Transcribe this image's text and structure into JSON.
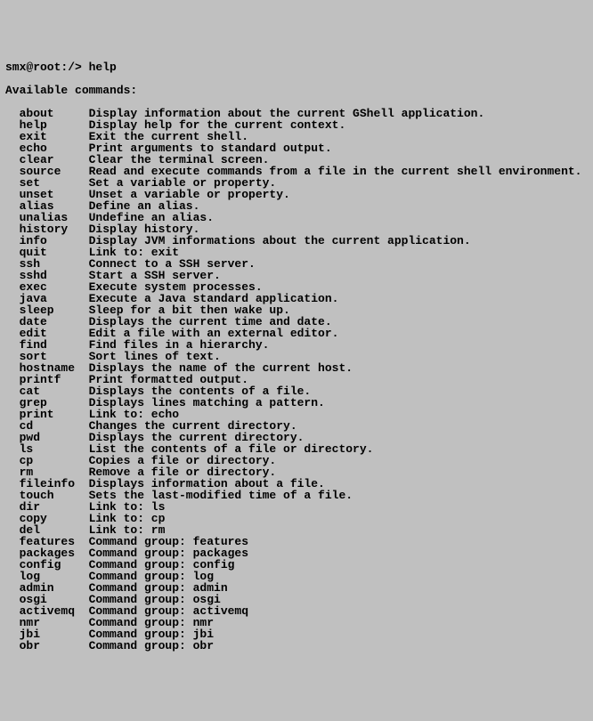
{
  "prompt": "smx@root:/> help",
  "header": "Available commands:",
  "commands": [
    {
      "name": "about",
      "desc": "Display information about the current GShell application."
    },
    {
      "name": "help",
      "desc": "Display help for the current context."
    },
    {
      "name": "exit",
      "desc": "Exit the current shell."
    },
    {
      "name": "echo",
      "desc": "Print arguments to standard output."
    },
    {
      "name": "clear",
      "desc": "Clear the terminal screen."
    },
    {
      "name": "source",
      "desc": "Read and execute commands from a file in the current shell environment."
    },
    {
      "name": "set",
      "desc": "Set a variable or property."
    },
    {
      "name": "unset",
      "desc": "Unset a variable or property."
    },
    {
      "name": "alias",
      "desc": "Define an alias."
    },
    {
      "name": "unalias",
      "desc": "Undefine an alias."
    },
    {
      "name": "history",
      "desc": "Display history."
    },
    {
      "name": "info",
      "desc": "Display JVM informations about the current application."
    },
    {
      "name": "quit",
      "desc": "Link to: exit"
    },
    {
      "name": "ssh",
      "desc": "Connect to a SSH server."
    },
    {
      "name": "sshd",
      "desc": "Start a SSH server."
    },
    {
      "name": "exec",
      "desc": "Execute system processes."
    },
    {
      "name": "java",
      "desc": "Execute a Java standard application."
    },
    {
      "name": "sleep",
      "desc": "Sleep for a bit then wake up."
    },
    {
      "name": "date",
      "desc": "Displays the current time and date."
    },
    {
      "name": "edit",
      "desc": "Edit a file with an external editor."
    },
    {
      "name": "find",
      "desc": "Find files in a hierarchy."
    },
    {
      "name": "sort",
      "desc": "Sort lines of text."
    },
    {
      "name": "hostname",
      "desc": "Displays the name of the current host."
    },
    {
      "name": "printf",
      "desc": "Print formatted output."
    },
    {
      "name": "cat",
      "desc": "Displays the contents of a file."
    },
    {
      "name": "grep",
      "desc": "Displays lines matching a pattern."
    },
    {
      "name": "print",
      "desc": "Link to: echo"
    },
    {
      "name": "cd",
      "desc": "Changes the current directory."
    },
    {
      "name": "pwd",
      "desc": "Displays the current directory."
    },
    {
      "name": "ls",
      "desc": "List the contents of a file or directory."
    },
    {
      "name": "cp",
      "desc": "Copies a file or directory."
    },
    {
      "name": "rm",
      "desc": "Remove a file or directory."
    },
    {
      "name": "fileinfo",
      "desc": "Displays information about a file."
    },
    {
      "name": "touch",
      "desc": "Sets the last-modified time of a file."
    },
    {
      "name": "dir",
      "desc": "Link to: ls"
    },
    {
      "name": "copy",
      "desc": "Link to: cp"
    },
    {
      "name": "del",
      "desc": "Link to: rm"
    },
    {
      "name": "features",
      "desc": "Command group: features"
    },
    {
      "name": "packages",
      "desc": "Command group: packages"
    },
    {
      "name": "config",
      "desc": "Command group: config"
    },
    {
      "name": "log",
      "desc": "Command group: log"
    },
    {
      "name": "admin",
      "desc": "Command group: admin"
    },
    {
      "name": "osgi",
      "desc": "Command group: osgi"
    },
    {
      "name": "activemq",
      "desc": "Command group: activemq"
    },
    {
      "name": "nmr",
      "desc": "Command group: nmr"
    },
    {
      "name": "jbi",
      "desc": "Command group: jbi"
    },
    {
      "name": "obr",
      "desc": "Command group: obr"
    }
  ]
}
